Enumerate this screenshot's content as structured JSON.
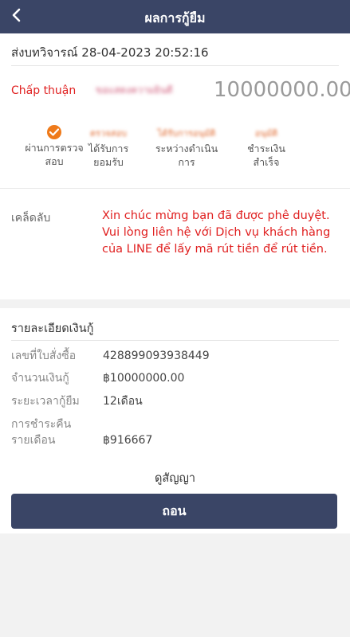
{
  "header": {
    "title": "ผลการกู้ยืม",
    "back_icon": "back-arrow-icon"
  },
  "summary": {
    "submit_label": "ส่งบทวิจารณ์",
    "submit_time": "28-04-2023 20:52:16",
    "status": "Chấp thuận",
    "name_blurred": "ขอแสดงความยินดี",
    "amount": "10000000.00"
  },
  "steps": [
    {
      "blur_text": "",
      "label": "ผ่านการตรวจสอบ",
      "icon": "check-circle-icon"
    },
    {
      "blur_text": "ตรวจสอบ",
      "label": "ได้รับการยอมรับ"
    },
    {
      "blur_text": "ได้รับการอนุมัติ",
      "label": "ระหว่างดำเนินการ"
    },
    {
      "blur_text": "อนุมัติ",
      "label": "ชำระเงินสำเร็จ"
    }
  ],
  "tips": {
    "label": "เคล็ดลับ",
    "text": "Xin chúc mừng bạn đã được phê duyệt. Vui lòng liên hệ với Dịch vụ khách hàng của LINE để lấy mã rút tiền để rút tiền."
  },
  "details": {
    "title": "รายละเอียดเงินกู้",
    "rows": [
      {
        "label": "เลขที่ใบสั่งซื้อ",
        "value": "428899093938449"
      },
      {
        "label": "จำนวนเงินกู้",
        "value": "฿10000000.00"
      },
      {
        "label": "ระยะเวลากู้ยืม",
        "value": "12เดือน"
      },
      {
        "label": "การชำระคืนรายเดือน",
        "value": "฿916667"
      }
    ],
    "contract_link": "ดูสัญญา",
    "withdraw_button": "ถอน"
  },
  "colors": {
    "navbar": "#3a4566",
    "status_red": "#e02020",
    "step_orange": "#ef7a1a"
  }
}
